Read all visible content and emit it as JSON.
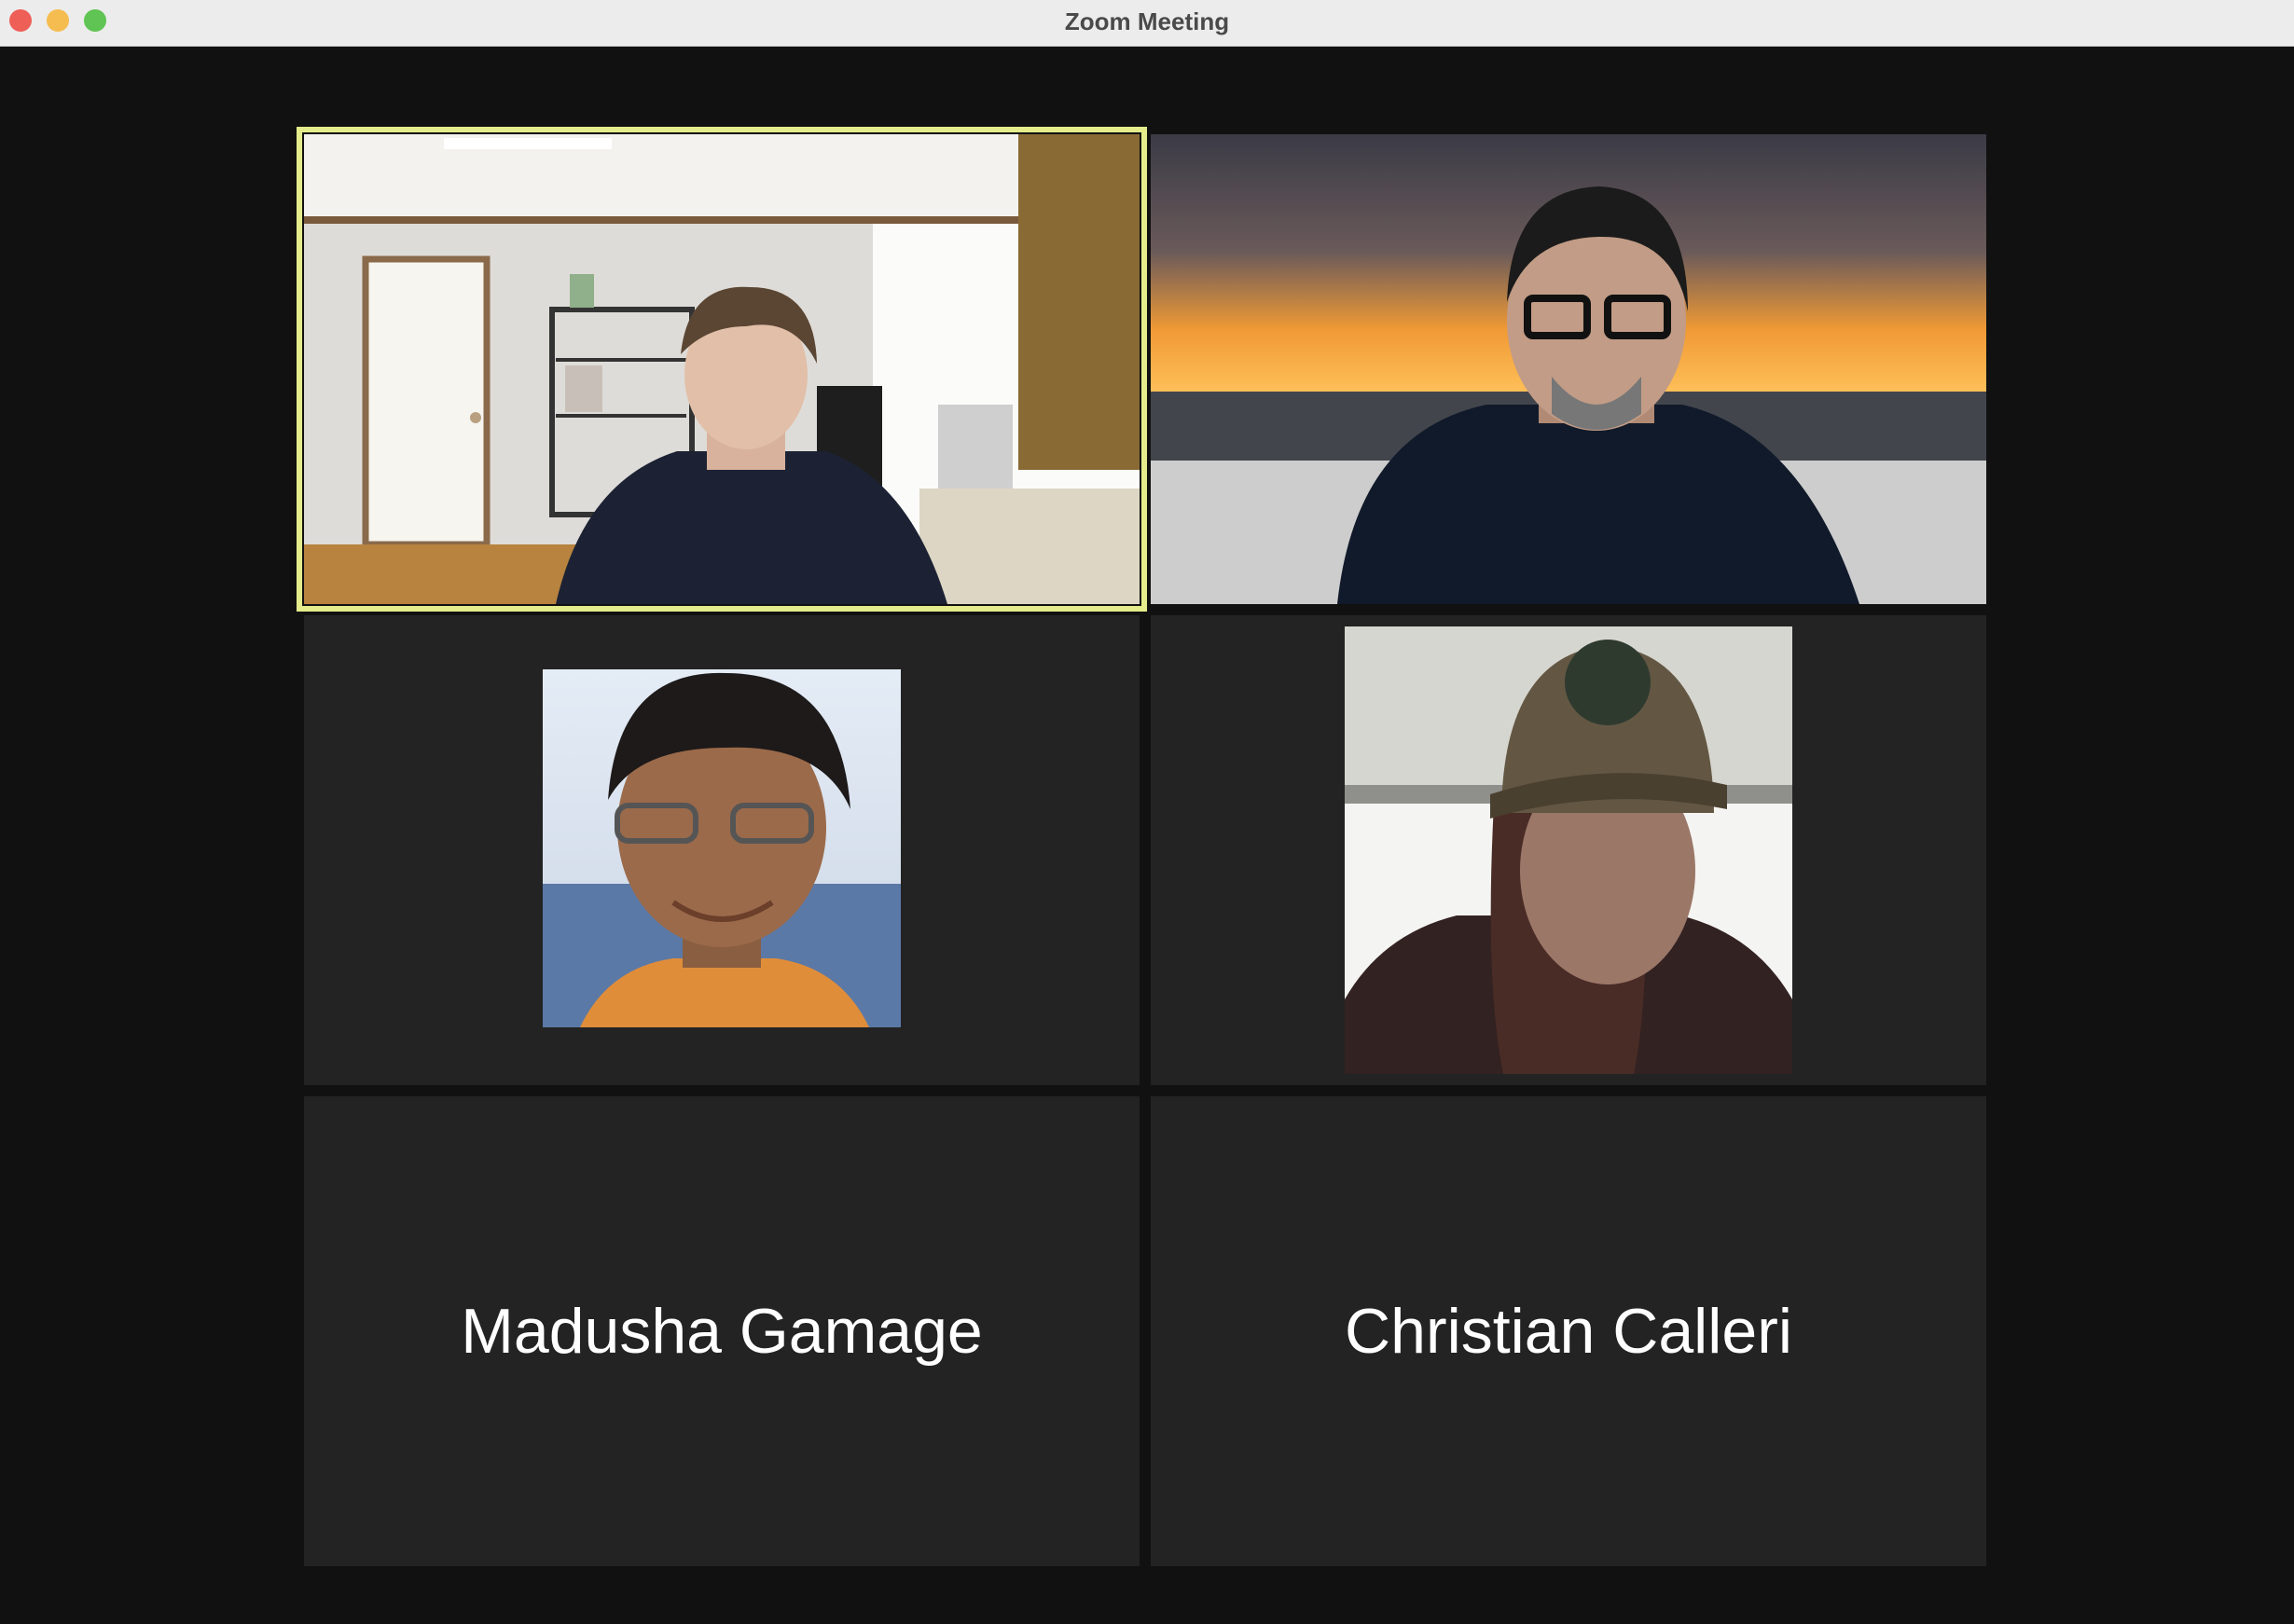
{
  "window": {
    "title": "Zoom Meeting"
  },
  "participants": [
    {
      "id": "p1",
      "name": "",
      "video": "on",
      "active_speaker": true
    },
    {
      "id": "p2",
      "name": "",
      "video": "on",
      "active_speaker": false
    },
    {
      "id": "p3",
      "name": "",
      "video": "profile-photo",
      "active_speaker": false
    },
    {
      "id": "p4",
      "name": "",
      "video": "on",
      "active_speaker": false
    },
    {
      "id": "p5",
      "name": "Madusha Gamage",
      "video": "off",
      "active_speaker": false
    },
    {
      "id": "p6",
      "name": "Christian Calleri",
      "video": "off",
      "active_speaker": false
    }
  ],
  "colors": {
    "active_speaker_border": "#e4ec8c",
    "tile_bg": "#232323",
    "stage_bg": "#111111"
  }
}
